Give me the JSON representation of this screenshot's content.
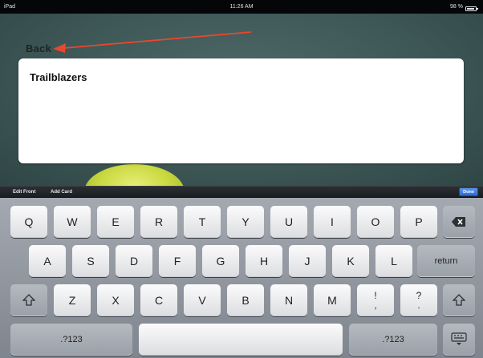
{
  "status_bar": {
    "device": "iPad",
    "time": "11:26 AM",
    "battery_text": "98 %"
  },
  "app": {
    "back_label": "Back",
    "card_text": "Trailblazers"
  },
  "toolbar": {
    "edit_front_label": "Edit Front",
    "add_card_label": "Add Card",
    "done_label": "Done"
  },
  "keyboard": {
    "row1": [
      "Q",
      "W",
      "E",
      "R",
      "T",
      "Y",
      "U",
      "I",
      "O",
      "P"
    ],
    "row2": [
      "A",
      "S",
      "D",
      "F",
      "G",
      "H",
      "J",
      "K",
      "L"
    ],
    "row3": [
      "Z",
      "X",
      "C",
      "V",
      "B",
      "N",
      "M"
    ],
    "return_label": "return",
    "exclaim_top": "!",
    "exclaim_bottom": ",",
    "question_top": "?",
    "question_bottom": ".",
    "numbers_label": ".?123"
  },
  "colors": {
    "done_button": "#3a78e0",
    "annotation_arrow": "#e8482e"
  }
}
